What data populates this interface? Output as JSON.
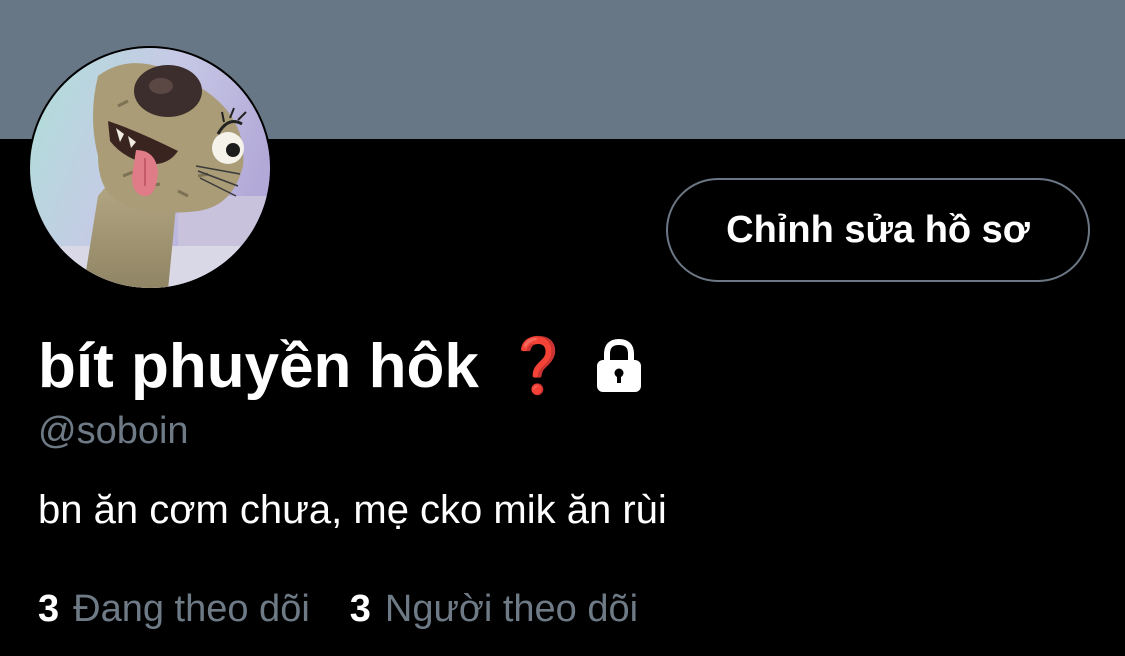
{
  "profile": {
    "display_name": "bít phuyền hôk",
    "name_badges": {
      "question_icon": "red-question-mark-icon",
      "question_glyph": "❓",
      "lock_icon": "lock-icon"
    },
    "handle": "@soboin",
    "bio": "bn ăn cơm chưa, mẹ cko mik ăn rùi",
    "avatar_icon": "sloth-avatar"
  },
  "actions": {
    "edit_profile_label": "Chỉnh sửa hồ sơ"
  },
  "stats": {
    "following_count": "3",
    "following_label": "Đang theo dõi",
    "followers_count": "3",
    "followers_label": "Người theo dõi"
  },
  "colors": {
    "background": "#000000",
    "banner": "#687786",
    "secondary_text": "#6e7a86",
    "button_border": "#6b7784",
    "question_red": "#d7261e"
  }
}
